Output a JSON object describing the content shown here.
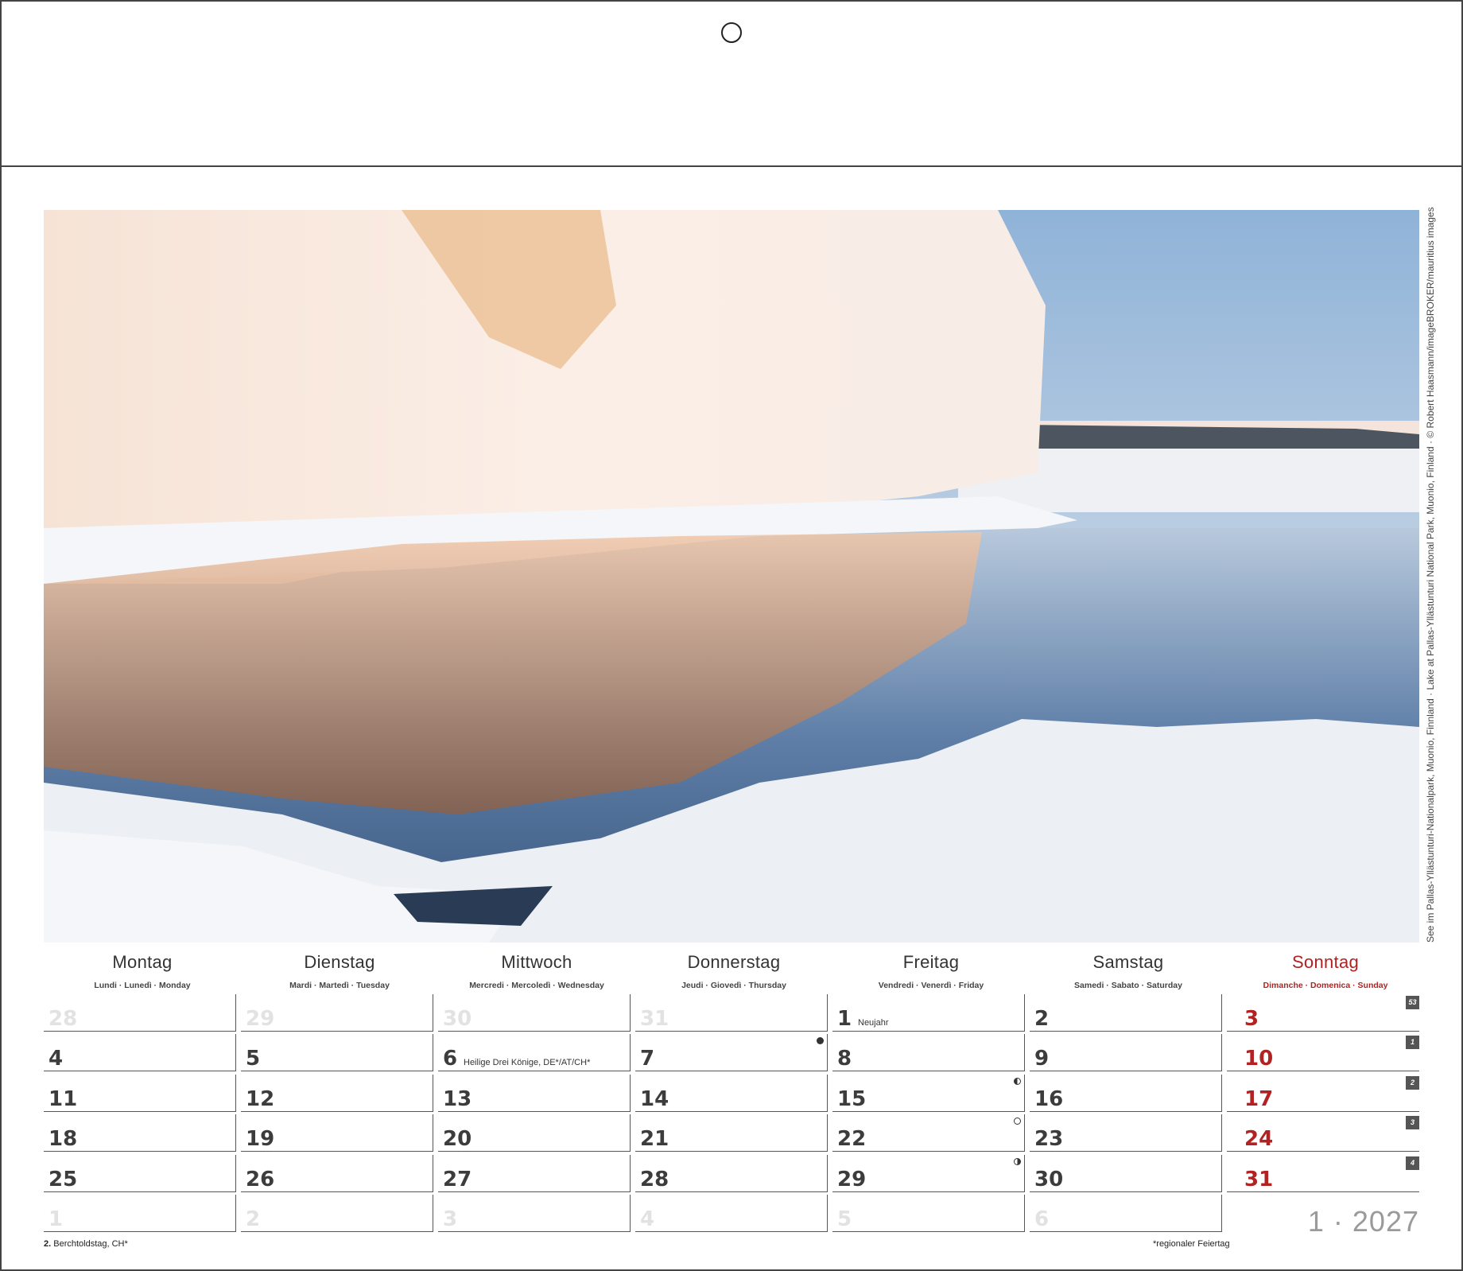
{
  "weekdays": [
    {
      "name": "Montag",
      "sub": "Lundi · Lunedì · Monday"
    },
    {
      "name": "Dienstag",
      "sub": "Mardi · Martedì · Tuesday"
    },
    {
      "name": "Mittwoch",
      "sub": "Mercredi · Mercoledì · Wednesday"
    },
    {
      "name": "Donnerstag",
      "sub": "Jeudi · Giovedì · Thursday"
    },
    {
      "name": "Freitag",
      "sub": "Vendredi · Venerdì · Friday"
    },
    {
      "name": "Samstag",
      "sub": "Samedi · Sabato · Saturday"
    },
    {
      "name": "Sonntag",
      "sub": "Dimanche · Domenica · Sunday"
    }
  ],
  "weeks": [
    {
      "badge": "53",
      "days": [
        "28",
        "29",
        "30",
        "31",
        "1",
        "2",
        "3"
      ],
      "dim": [
        0,
        1,
        2,
        3
      ],
      "holidays": {
        "4": "Neujahr"
      },
      "moons": {}
    },
    {
      "badge": "1",
      "days": [
        "4",
        "5",
        "6",
        "7",
        "8",
        "9",
        "10"
      ],
      "dim": [],
      "holidays": {
        "2": "Heilige Drei Könige, DE*/AT/CH*"
      },
      "moons": {
        "3": "new"
      }
    },
    {
      "badge": "2",
      "days": [
        "11",
        "12",
        "13",
        "14",
        "15",
        "16",
        "17"
      ],
      "dim": [],
      "holidays": {},
      "moons": {
        "4": "half-l"
      }
    },
    {
      "badge": "3",
      "days": [
        "18",
        "19",
        "20",
        "21",
        "22",
        "23",
        "24"
      ],
      "dim": [],
      "holidays": {},
      "moons": {
        "4": "full"
      }
    },
    {
      "badge": "4",
      "days": [
        "25",
        "26",
        "27",
        "28",
        "29",
        "30",
        "31"
      ],
      "dim": [],
      "holidays": {},
      "moons": {
        "4": "half-r"
      }
    },
    {
      "badge": "",
      "days": [
        "1",
        "2",
        "3",
        "4",
        "5",
        "6",
        ""
      ],
      "dim": [
        0,
        1,
        2,
        3,
        4,
        5
      ],
      "holidays": {},
      "moons": {}
    }
  ],
  "month_year": "1 · 2027",
  "footnote_left_day": "2.",
  "footnote_left_text": " Berchtoldstag, CH*",
  "footnote_right": "*regionaler Feiertag",
  "photo_credit": "See im Pallas-Yllästunturi-Nationalpark, Muonio, Finnland · Lake at Pallas-Yllästunturi National Park, Muonio, Finland · © Robert Haasmann/imageBROKER/mauritius images",
  "colors": {
    "sunday": "#b22222",
    "grid": "#555555",
    "dim_number": "#e2e2e2"
  }
}
